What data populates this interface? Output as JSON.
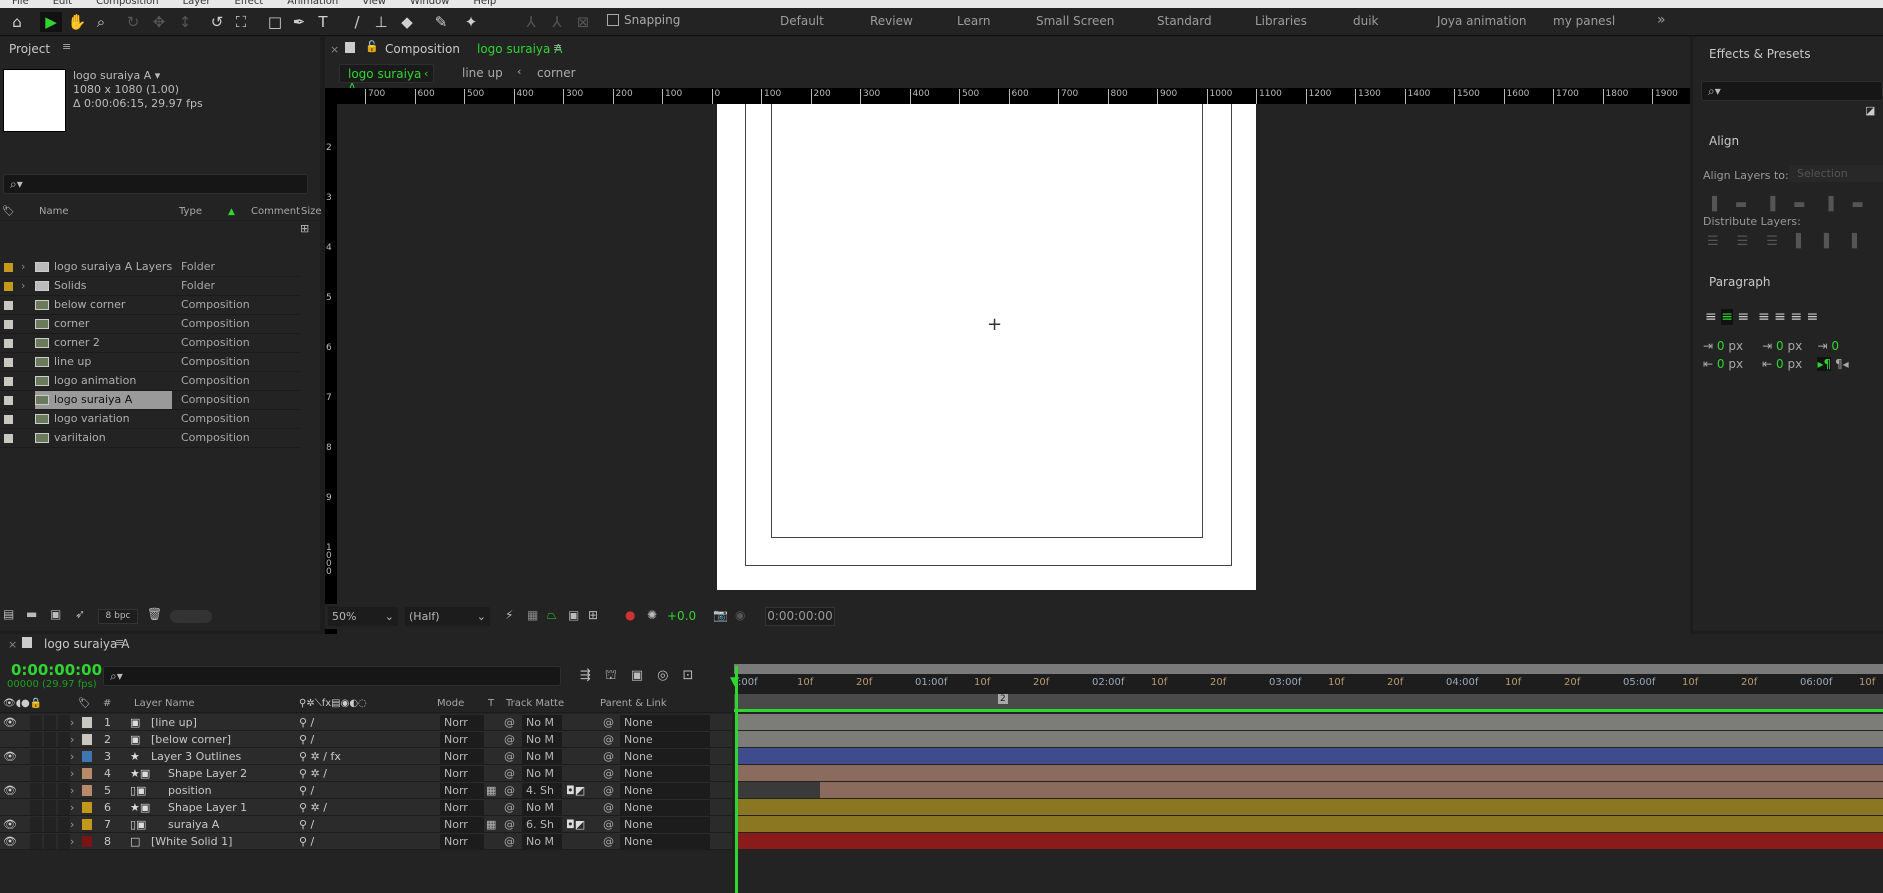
{
  "menu": [
    "File",
    "Edit",
    "Composition",
    "Layer",
    "Effect",
    "Animation",
    "View",
    "Window",
    "Help"
  ],
  "toolbar": {
    "tools": [
      {
        "icon": "home-icon",
        "glyph": "⌂"
      },
      {
        "icon": "selection-tool-icon",
        "glyph": "▶",
        "active": true
      },
      {
        "icon": "hand-tool-icon",
        "glyph": "✋"
      },
      {
        "icon": "zoom-tool-icon",
        "glyph": "⌕"
      },
      {
        "icon": "orbit-camera-icon",
        "glyph": "↻",
        "dim": true
      },
      {
        "icon": "pan-camera-icon",
        "glyph": "✥",
        "dim": true
      },
      {
        "icon": "dolly-camera-icon",
        "glyph": "↕",
        "dim": true
      },
      {
        "icon": "rotate-tool-icon",
        "glyph": "↺"
      },
      {
        "icon": "pan-behind-icon",
        "glyph": "⛶"
      },
      {
        "icon": "rectangle-tool-icon",
        "glyph": "□"
      },
      {
        "icon": "pen-tool-icon",
        "glyph": "✒"
      },
      {
        "icon": "type-tool-icon",
        "glyph": "T"
      },
      {
        "icon": "brush-tool-icon",
        "glyph": "/"
      },
      {
        "icon": "clone-stamp-icon",
        "glyph": "⊥"
      },
      {
        "icon": "eraser-tool-icon",
        "glyph": "◆"
      },
      {
        "icon": "roto-brush-icon",
        "glyph": "✎"
      },
      {
        "icon": "puppet-pin-icon",
        "glyph": "✦"
      },
      {
        "icon": "local-axis-icon",
        "glyph": "⅄",
        "dim": true
      },
      {
        "icon": "world-axis-icon",
        "glyph": "⅄",
        "dim": true
      },
      {
        "icon": "view-axis-icon",
        "glyph": "⊠",
        "dim": true
      }
    ],
    "snapping_label": "Snapping",
    "workspaces": [
      "Default",
      "Review",
      "Learn",
      "Small Screen",
      "Standard",
      "Libraries",
      "duik",
      "Joya animation",
      "my panesl"
    ],
    "more": "»"
  },
  "project": {
    "title": "Project",
    "comp_name": "logo suraiya A ▾",
    "comp_size": "1080 x 1080 (1.00)",
    "comp_duration": "Δ 0:00:06:15, 29.97 fps",
    "search_icon": "⌕▾",
    "columns": [
      "Name",
      "Type",
      "Comment",
      "Size"
    ],
    "items": [
      {
        "name": "logo suraiya A Layers",
        "type": "Folder",
        "kind": "folder",
        "label": "#c39a1c"
      },
      {
        "name": "Solids",
        "type": "Folder",
        "kind": "folder",
        "label": "#c39a1c"
      },
      {
        "name": "below corner",
        "type": "Composition",
        "kind": "comp",
        "label": "#c8c8c0"
      },
      {
        "name": "corner",
        "type": "Composition",
        "kind": "comp",
        "label": "#c8c8c0"
      },
      {
        "name": "corner 2",
        "type": "Composition",
        "kind": "comp",
        "label": "#c8c8c0"
      },
      {
        "name": "line up",
        "type": "Composition",
        "kind": "comp",
        "label": "#c8c8c0"
      },
      {
        "name": "logo animation",
        "type": "Composition",
        "kind": "comp",
        "label": "#c8c8c0"
      },
      {
        "name": "logo suraiya A",
        "type": "Composition",
        "kind": "comp",
        "label": "#c8c8c0",
        "selected": true
      },
      {
        "name": "logo variation",
        "type": "Composition",
        "kind": "comp",
        "label": "#c8c8c0"
      },
      {
        "name": "variitaion",
        "type": "Composition",
        "kind": "comp",
        "label": "#c8c8c0"
      }
    ],
    "bpc": "8 bpc"
  },
  "composition": {
    "tab_prefix": "Composition",
    "tab_name": "logo suraiya A",
    "breadcrumbs": [
      "logo suraiya A",
      "line up",
      "corner"
    ],
    "h_ruler": [
      "700",
      "600",
      "500",
      "400",
      "300",
      "200",
      "100",
      "0",
      "100",
      "200",
      "300",
      "400",
      "500",
      "600",
      "700",
      "800",
      "900",
      "1000",
      "1100",
      "1200",
      "1300",
      "1400",
      "1500",
      "1600",
      "1700",
      "1800",
      "1900"
    ],
    "v_ruler": [
      "2",
      "3",
      "4",
      "5",
      "6",
      "7",
      "8",
      "9",
      "1000"
    ],
    "zoom": "50%",
    "resolution": "(Half)",
    "exposure": "+0.0",
    "timecode": "0:00:00:00"
  },
  "right": {
    "effects_title": "Effects & Presets",
    "align_title": "Align",
    "align_to_label": "Align Layers to:",
    "align_to_value": "Selection",
    "distribute_label": "Distribute Layers:",
    "paragraph_title": "Paragraph",
    "px_values": [
      "0",
      "0",
      "0",
      "0",
      "0"
    ],
    "px_unit": "px"
  },
  "timeline": {
    "tab": "logo suraiya A",
    "timecode": "0:00:00:00",
    "frame_info": "00000 (29.97 fps)",
    "columns": {
      "layer_name": "Layer Name",
      "num": "#",
      "mode": "Mode",
      "t": "T",
      "track_matte": "Track Matte",
      "parent": "Parent & Link"
    },
    "ruler": [
      ":00f",
      "10f",
      "20f",
      "01:00f",
      "10f",
      "20f",
      "02:00f",
      "10f",
      "20f",
      "03:00f",
      "10f",
      "20f",
      "04:00f",
      "10f",
      "20f",
      "05:00f",
      "10f",
      "20f",
      "06:00f",
      "10f"
    ],
    "marker": "2",
    "layers": [
      {
        "num": "1",
        "name": "[line up]",
        "label": "#c8c8c0",
        "icon": "comp",
        "visible": true,
        "mode": "Norr",
        "matte": "No M",
        "parent": "None",
        "bar": "#7c7c78"
      },
      {
        "num": "2",
        "name": "[below corner]",
        "label": "#c8c8c0",
        "icon": "comp",
        "visible": false,
        "mode": "Norr",
        "matte": "No M",
        "parent": "None",
        "bar": "#7c7c78"
      },
      {
        "num": "3",
        "name": "Layer 3 Outlines",
        "label": "#3f76b0",
        "icon": "shape",
        "visible": true,
        "fx": true,
        "mode": "Norr",
        "matte": "No M",
        "parent": "None",
        "bar": "#3e4b8c"
      },
      {
        "num": "4",
        "name": "Shape Layer 2",
        "label": "#b98a6a",
        "icon": "shape-mask",
        "visible": false,
        "mode": "Norr",
        "matte": "No M",
        "parent": "None",
        "bar": "#8a6b5e"
      },
      {
        "num": "5",
        "name": "position",
        "label": "#b98a6a",
        "icon": "file-mask",
        "visible": true,
        "mode": "Norr",
        "matte": "4. Sh",
        "parent": "None",
        "bar": "#8a6b5e",
        "matte_icons": true
      },
      {
        "num": "6",
        "name": "Shape Layer 1",
        "label": "#c3961c",
        "icon": "shape-mask",
        "visible": false,
        "mode": "Norr",
        "matte": "No M",
        "parent": "None",
        "bar": "#8b7622"
      },
      {
        "num": "7",
        "name": "suraiya A",
        "label": "#c3961c",
        "icon": "file-mask",
        "visible": true,
        "mode": "Norr",
        "matte": "6. Sh",
        "parent": "None",
        "bar": "#8b7622",
        "matte_icons": true
      },
      {
        "num": "8",
        "name": "[White Solid 1]",
        "label": "#7a1414",
        "icon": "solid",
        "visible": true,
        "mode": "Norr",
        "matte": "No M",
        "parent": "None",
        "bar": "#8a1b1b"
      }
    ]
  },
  "colors": {
    "accent": "#2fd62f",
    "panel": "#232323",
    "highlight": "#2d8ceb"
  }
}
